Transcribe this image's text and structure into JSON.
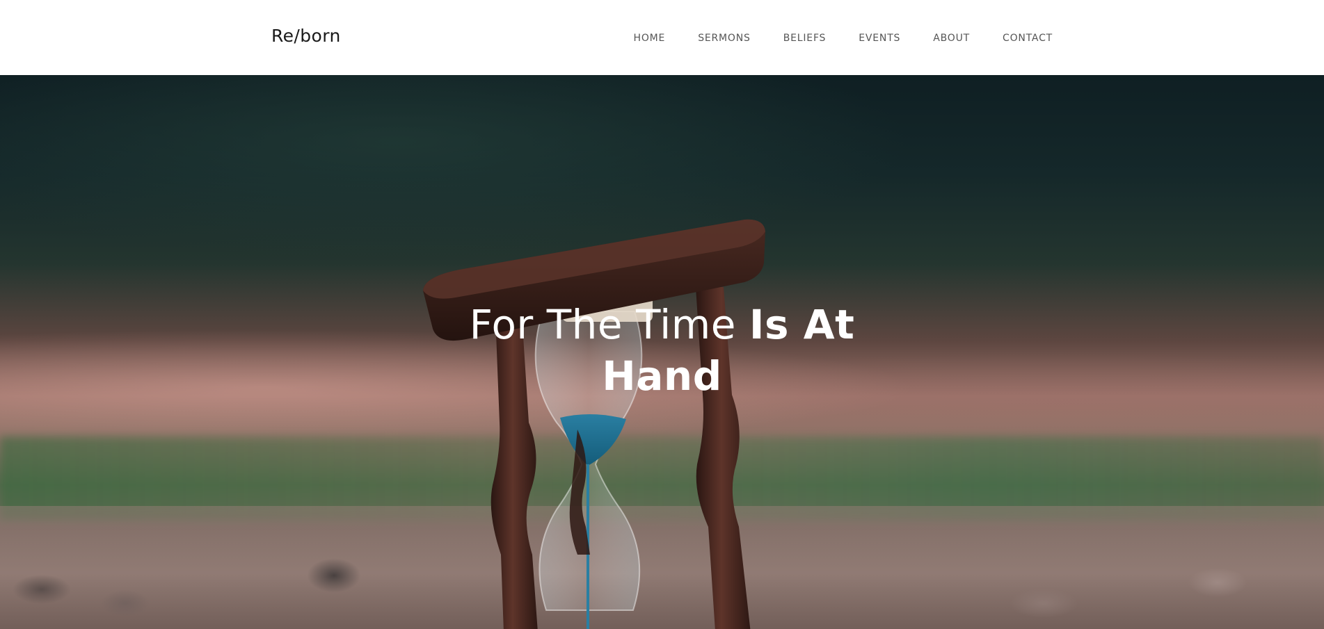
{
  "header": {
    "logo": "Re/born",
    "nav": [
      {
        "label": "HOME"
      },
      {
        "label": "SERMONS"
      },
      {
        "label": "BELIEFS"
      },
      {
        "label": "EVENTS"
      },
      {
        "label": "ABOUT"
      },
      {
        "label": "CONTACT"
      }
    ]
  },
  "hero": {
    "title_light": "For The Time ",
    "title_bold_line1": "Is At",
    "title_bold_line2": "Hand"
  },
  "colors": {
    "header_bg": "#ffffff",
    "logo_text": "#1a1a1a",
    "nav_text": "#555555",
    "hero_text": "#ffffff",
    "sand_blue": "#1f6f8f"
  },
  "icons": {
    "hero_image": "hourglass-image"
  }
}
